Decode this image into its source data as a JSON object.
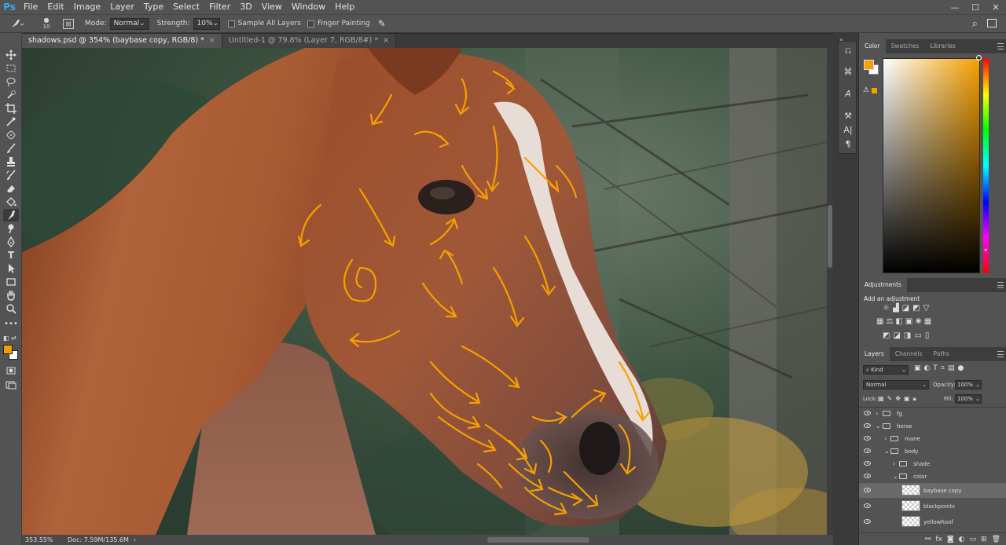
{
  "app": {
    "logo": "Ps"
  },
  "menu": [
    "File",
    "Edit",
    "Image",
    "Layer",
    "Type",
    "Select",
    "Filter",
    "3D",
    "View",
    "Window",
    "Help"
  ],
  "window_controls": [
    "—",
    "☐",
    "✕"
  ],
  "options": {
    "brush_size": "10",
    "mode_label": "Mode:",
    "mode_value": "Normal",
    "strength_label": "Strength:",
    "strength_value": "10%",
    "sample_all_layers": "Sample All Layers",
    "finger_painting": "Finger Painting"
  },
  "tabs": [
    {
      "label": "shadows.psd @ 354% (baybase copy, RGB/8) *",
      "active": true
    },
    {
      "label": "Untitled-1 @ 79.8% (Layer 7, RGB/8#) *",
      "active": false
    }
  ],
  "status": {
    "zoom": "353.55%",
    "doc": "Doc: 7.59M/135.6M"
  },
  "color_panel": {
    "tabs": [
      "Color",
      "Swatches",
      "Libraries"
    ],
    "foreground": "#f5a000",
    "background": "#ffffff"
  },
  "adjustments": {
    "tab": "Adjustments",
    "title": "Add an adjustment"
  },
  "layers_panel": {
    "tabs": [
      "Layers",
      "Channels",
      "Paths"
    ],
    "kind_label": "⌕ Kind",
    "blend_mode": "Normal",
    "opacity_label": "Opacity:",
    "opacity_value": "100%",
    "lock_label": "Lock:",
    "fill_label": "Fill:",
    "fill_value": "100%",
    "layers": [
      {
        "name": "fg",
        "type": "group",
        "indent": 0,
        "open": false
      },
      {
        "name": "horse",
        "type": "group",
        "indent": 0,
        "open": true
      },
      {
        "name": "mane",
        "type": "group",
        "indent": 1,
        "open": false
      },
      {
        "name": "body",
        "type": "group",
        "indent": 1,
        "open": true
      },
      {
        "name": "shade",
        "type": "group",
        "indent": 2,
        "open": false
      },
      {
        "name": "color",
        "type": "group",
        "indent": 2,
        "open": true
      },
      {
        "name": "baybase copy",
        "type": "layer",
        "selected": true
      },
      {
        "name": "blackpoints",
        "type": "layer"
      },
      {
        "name": "yellowhoof",
        "type": "layer"
      }
    ]
  }
}
